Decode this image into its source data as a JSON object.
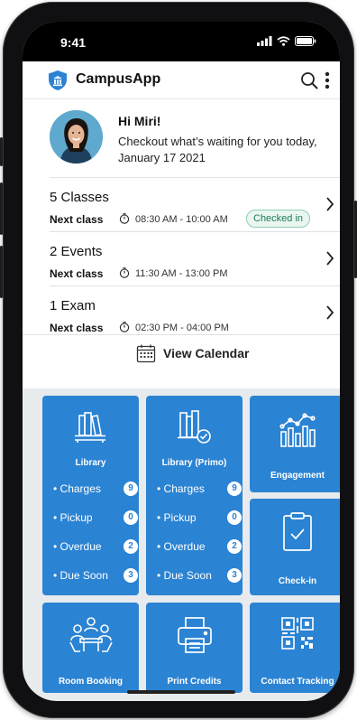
{
  "status_bar": {
    "time": "9:41"
  },
  "app": {
    "title": "CampusApp",
    "accent": "#2b83d3"
  },
  "greeting": {
    "title": "Hi Miri!",
    "subtitle": "Checkout what’s waiting for you today, January 17 2021"
  },
  "schedule": [
    {
      "count": "5 Classes",
      "next_label": "Next class",
      "time": "08:30 AM - 10:00 AM",
      "badge": "Checked in"
    },
    {
      "count": "2 Events",
      "next_label": "Next class",
      "time": "11:30 AM - 13:00 PM",
      "badge": null
    },
    {
      "count": "1 Exam",
      "next_label": "Next class",
      "time": "02:30 PM - 04:00 PM",
      "badge": null
    }
  ],
  "view_calendar": "View Calendar",
  "tiles": {
    "library": {
      "title": "Library",
      "icon": "books-on-shelf-icon",
      "stats": [
        {
          "label": "• Charges",
          "count": "9"
        },
        {
          "label": "• Pickup",
          "count": "0"
        },
        {
          "label": "• Overdue",
          "count": "2"
        },
        {
          "label": "• Due Soon",
          "count": "3"
        }
      ]
    },
    "library_primo": {
      "title": "Library (Primo)",
      "icon": "books-check-icon",
      "stats": [
        {
          "label": "• Charges",
          "count": "9"
        },
        {
          "label": "• Pickup",
          "count": "0"
        },
        {
          "label": "• Overdue",
          "count": "2"
        },
        {
          "label": "• Due Soon",
          "count": "3"
        }
      ]
    },
    "engagement": {
      "title": "Engagement",
      "icon": "bar-chart-icon"
    },
    "check_in": {
      "title": "Check-in",
      "icon": "clipboard-check-icon"
    },
    "room_booking": {
      "title": "Room Booking",
      "icon": "meeting-table-icon"
    },
    "print_credits": {
      "title": "Print Credits",
      "icon": "printer-icon"
    },
    "contact_tracking": {
      "title": "Contact Tracking",
      "icon": "qr-code-icon"
    }
  }
}
